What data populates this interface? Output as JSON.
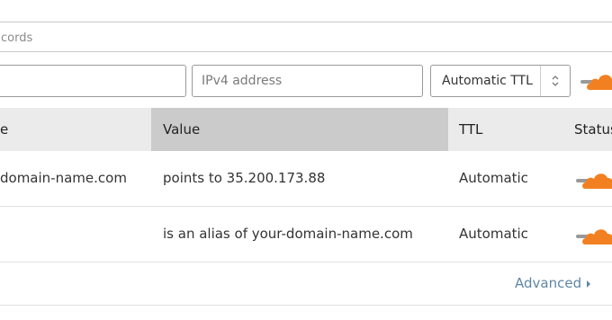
{
  "search": {
    "text": "cords"
  },
  "form": {
    "name_placeholder": "",
    "ipv4_placeholder": "IPv4 address",
    "ttl_value": "Automatic TTL"
  },
  "table": {
    "columns": [
      "e",
      "Value",
      "TTL",
      "Status"
    ],
    "rows": [
      {
        "name": "domain-name.com",
        "value": "points to 35.200.173.88",
        "ttl": "Automatic"
      },
      {
        "name": "",
        "value": "is an alias of your-domain-name.com",
        "ttl": "Automatic"
      }
    ]
  },
  "advanced_label": "Advanced",
  "colors": {
    "accent": "#f38020",
    "link": "#5f86a5",
    "header_bg": "#ebebeb",
    "sorted_header_bg": "#cbcbcb"
  },
  "icons": [
    "cloud-proxy-icon",
    "sort-arrows-icon",
    "chevron-right-icon"
  ]
}
